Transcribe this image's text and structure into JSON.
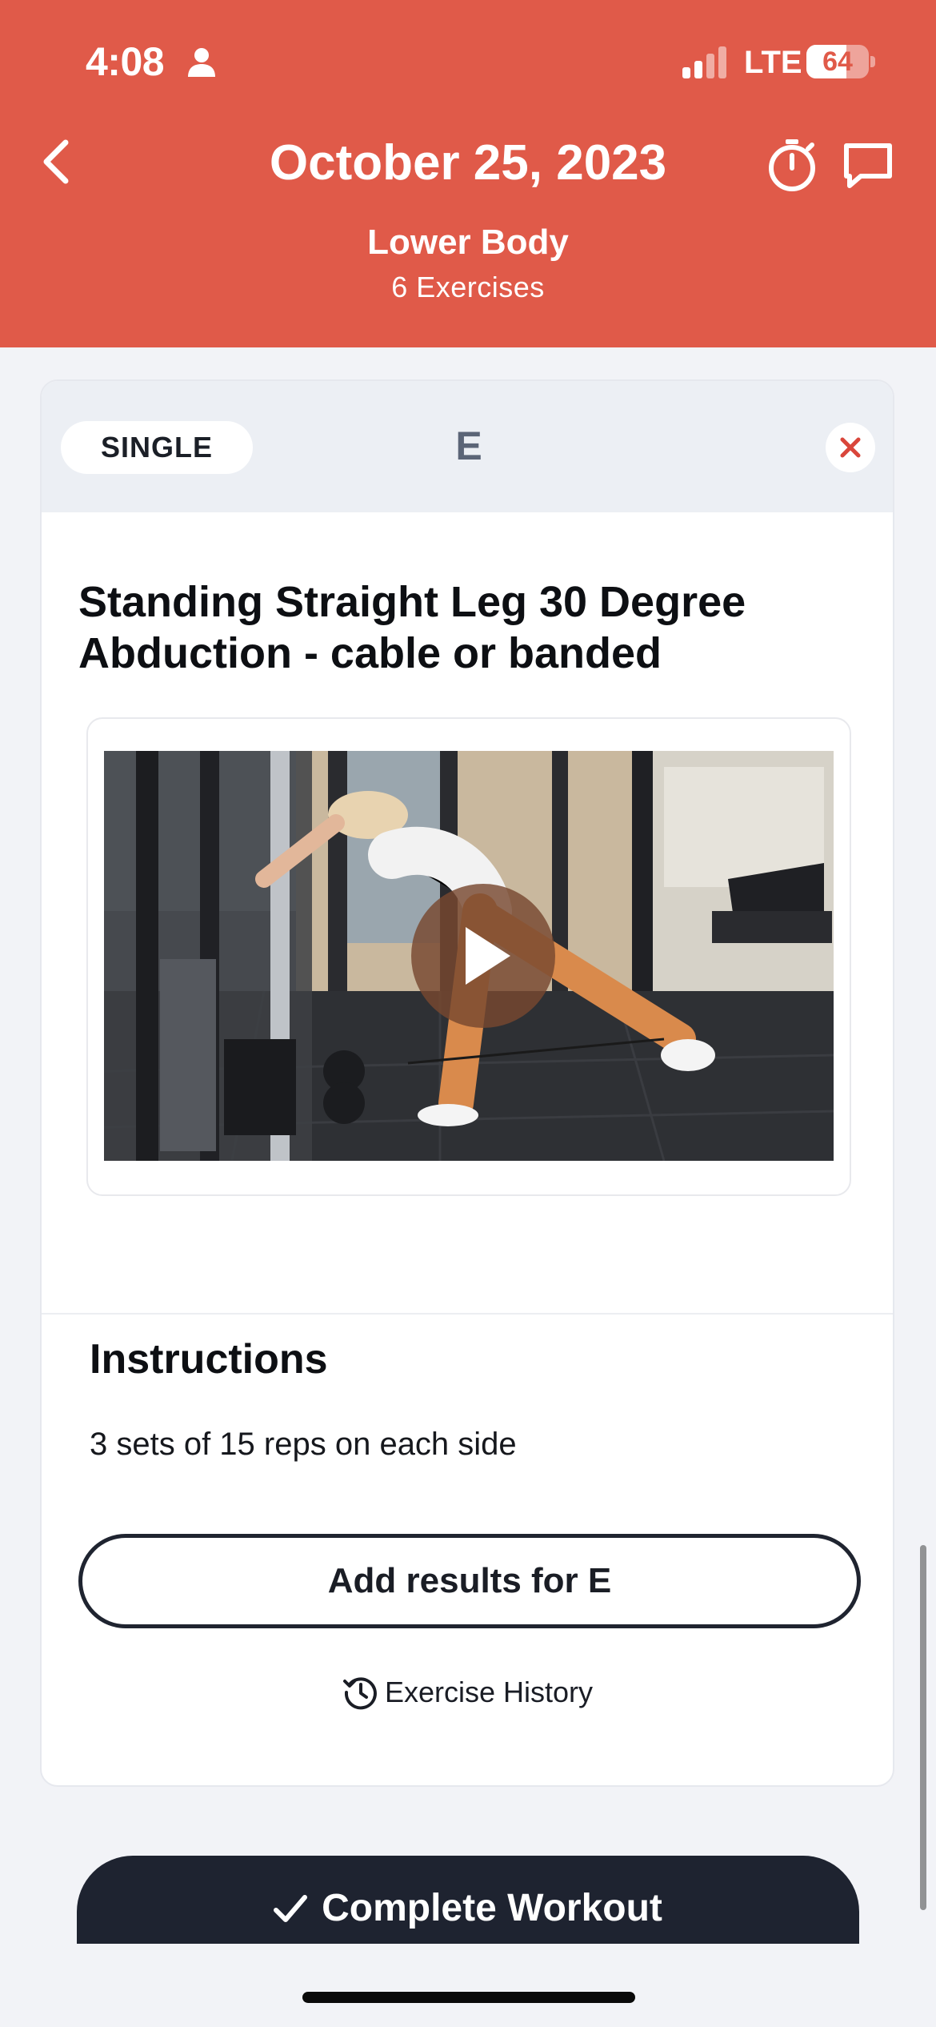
{
  "status_bar": {
    "time": "4:08",
    "network": "LTE",
    "battery_level": "64",
    "battery_fraction": 0.64
  },
  "header": {
    "title": "October 25, 2023",
    "subtitle": "Lower Body",
    "exercise_count": "6 Exercises",
    "background_color": "#e05a49",
    "icons": [
      "back-icon",
      "stopwatch-icon",
      "chat-icon"
    ]
  },
  "exercise_card": {
    "type_badge": "SINGLE",
    "letter": "E",
    "title": "Standing Straight Leg 30 Degree Abduction - cable or banded",
    "video": {
      "play_icon": "play-icon"
    },
    "instructions_heading": "Instructions",
    "instructions_text": "3 sets of 15 reps on each side",
    "add_results_label": "Add results for E",
    "history_label": "Exercise History"
  },
  "footer": {
    "complete_label": "Complete Workout",
    "button_color": "#1e2330"
  }
}
